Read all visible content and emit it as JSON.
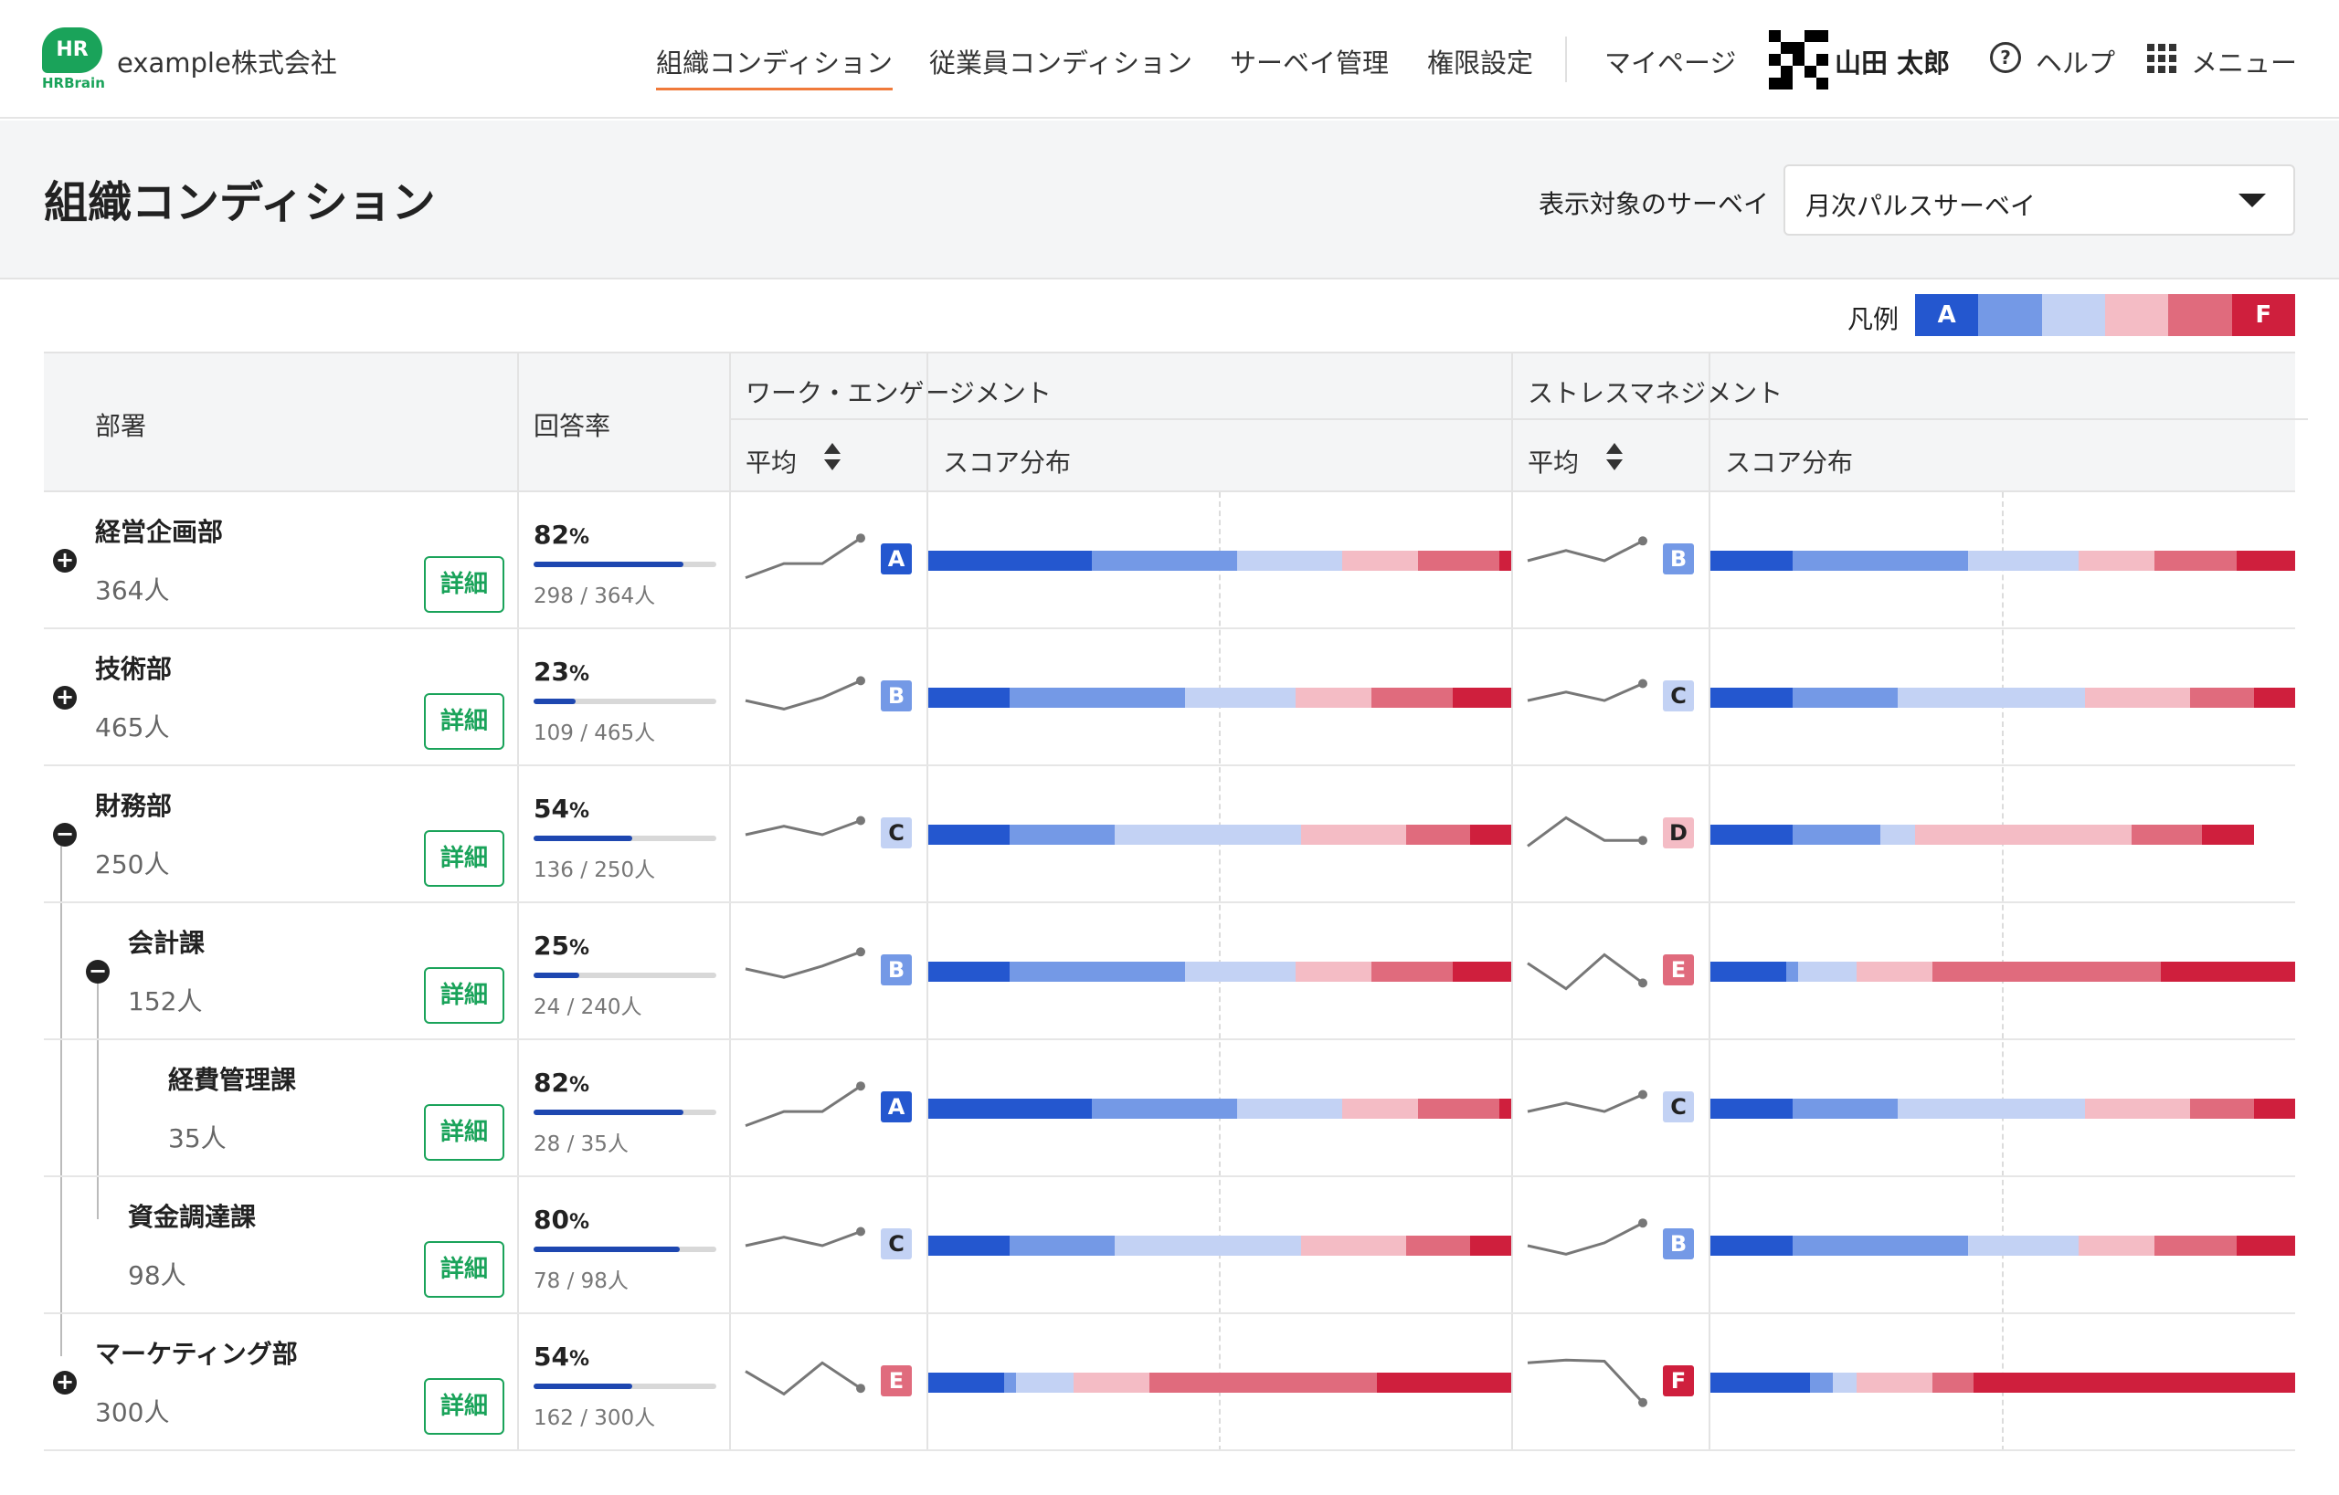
{
  "header": {
    "logo_text": "HR",
    "logo_sub": "HRBrain",
    "company": "example株式会社",
    "nav": [
      {
        "label": "組織コンディション",
        "active": true
      },
      {
        "label": "従業員コンディション",
        "active": false
      },
      {
        "label": "サーベイ管理",
        "active": false
      },
      {
        "label": "権限設定",
        "active": false
      },
      {
        "label": "マイページ",
        "active": false
      }
    ],
    "user_name": "山田 太郎",
    "help_label": "ヘルプ",
    "menu_label": "メニュー"
  },
  "page": {
    "title": "組織コンディション",
    "survey_label": "表示対象のサーベイ",
    "survey_selected": "月次パルスサーベイ"
  },
  "legend": {
    "label": "凡例",
    "first": "A",
    "last": "F",
    "colors": [
      "#2457cf",
      "#7499e6",
      "#c3d2f4",
      "#f4bcc5",
      "#e06b7d",
      "#cf1f3d"
    ]
  },
  "table": {
    "headers": {
      "dept": "部署",
      "rate": "回答率",
      "engagement": "ワーク・エンゲージメント",
      "stress": "ストレスマネジメント",
      "avg": "平均",
      "dist": "スコア分布"
    },
    "detail_label": "詳細",
    "rows": [
      {
        "name": "経営企画部",
        "count": "364人",
        "depth": 0,
        "toggle": "+",
        "rate_pct": "82",
        "rate": 0.82,
        "rate_detail": "298 / 364人",
        "eng_grade": "A",
        "eng_spark": [
          0.2,
          0.45,
          0.45,
          0.9
        ],
        "eng_dist": [
          0.28,
          0.25,
          0.18,
          0.13,
          0.14,
          0.02
        ],
        "str_grade": "B",
        "str_spark": [
          0.5,
          0.68,
          0.5,
          0.85
        ],
        "str_dist": [
          0.14,
          0.3,
          0.19,
          0.13,
          0.14,
          0.1
        ]
      },
      {
        "name": "技術部",
        "count": "465人",
        "depth": 0,
        "toggle": "+",
        "rate_pct": "23",
        "rate": 0.23,
        "rate_detail": "109 / 465人",
        "eng_grade": "B",
        "eng_spark": [
          0.45,
          0.3,
          0.5,
          0.8
        ],
        "eng_dist": [
          0.14,
          0.3,
          0.19,
          0.13,
          0.14,
          0.1
        ],
        "str_grade": "C",
        "str_spark": [
          0.45,
          0.6,
          0.45,
          0.75
        ],
        "str_dist": [
          0.14,
          0.18,
          0.32,
          0.18,
          0.11,
          0.07
        ]
      },
      {
        "name": "財務部",
        "count": "250人",
        "depth": 0,
        "toggle": "−",
        "rate_pct": "54",
        "rate": 0.54,
        "rate_detail": "136 / 250人",
        "eng_grade": "C",
        "eng_spark": [
          0.5,
          0.65,
          0.5,
          0.75
        ],
        "eng_dist": [
          0.14,
          0.18,
          0.32,
          0.18,
          0.11,
          0.07
        ],
        "str_grade": "D",
        "str_spark": [
          0.3,
          0.8,
          0.4,
          0.4
        ],
        "str_dist": [
          0.14,
          0.15,
          0.06,
          0.37,
          0.12,
          0.09
        ]
      },
      {
        "name": "会計課",
        "count": "152人",
        "depth": 1,
        "toggle": "−",
        "rate_pct": "25",
        "rate": 0.25,
        "rate_detail": "24 / 240人",
        "eng_grade": "B",
        "eng_spark": [
          0.55,
          0.4,
          0.6,
          0.85
        ],
        "eng_dist": [
          0.14,
          0.3,
          0.19,
          0.13,
          0.14,
          0.1
        ],
        "str_grade": "E",
        "str_spark": [
          0.65,
          0.2,
          0.8,
          0.3
        ],
        "str_dist": [
          0.13,
          0.02,
          0.1,
          0.13,
          0.39,
          0.23
        ]
      },
      {
        "name": "経費管理課",
        "count": "35人",
        "depth": 2,
        "toggle": "",
        "rate_pct": "82",
        "rate": 0.82,
        "rate_detail": "28 / 35人",
        "eng_grade": "A",
        "eng_spark": [
          0.2,
          0.45,
          0.45,
          0.9
        ],
        "eng_dist": [
          0.28,
          0.25,
          0.18,
          0.13,
          0.14,
          0.02
        ],
        "str_grade": "C",
        "str_spark": [
          0.45,
          0.6,
          0.45,
          0.75
        ],
        "str_dist": [
          0.14,
          0.18,
          0.32,
          0.18,
          0.11,
          0.07
        ]
      },
      {
        "name": "資金調達課",
        "count": "98人",
        "depth": 1,
        "toggle": "",
        "rate_pct": "80",
        "rate": 0.8,
        "rate_detail": "78 / 98人",
        "eng_grade": "C",
        "eng_spark": [
          0.5,
          0.65,
          0.5,
          0.75
        ],
        "eng_dist": [
          0.14,
          0.18,
          0.32,
          0.18,
          0.11,
          0.07
        ],
        "str_grade": "B",
        "str_spark": [
          0.5,
          0.35,
          0.55,
          0.9
        ],
        "str_dist": [
          0.14,
          0.3,
          0.19,
          0.13,
          0.14,
          0.1
        ]
      },
      {
        "name": "マーケティング部",
        "count": "300人",
        "depth": 0,
        "toggle": "+",
        "rate_pct": "54",
        "rate": 0.54,
        "rate_detail": "162 / 300人",
        "eng_grade": "E",
        "eng_spark": [
          0.7,
          0.3,
          0.85,
          0.4
        ],
        "eng_dist": [
          0.13,
          0.02,
          0.1,
          0.13,
          0.39,
          0.23
        ],
        "str_grade": "F",
        "str_spark": [
          0.85,
          0.9,
          0.88,
          0.15
        ],
        "str_dist": [
          0.17,
          0.04,
          0.04,
          0.13,
          0.07,
          0.55
        ]
      }
    ]
  }
}
